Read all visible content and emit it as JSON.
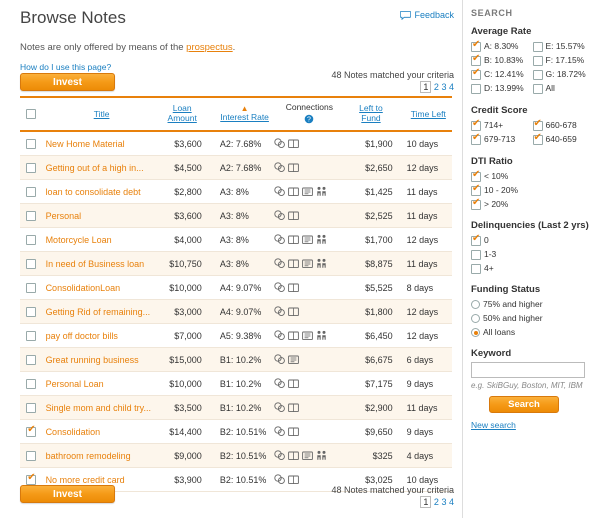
{
  "header": {
    "title": "Browse Notes",
    "feedback_label": "Feedback",
    "feedback_icon": "speech-bubble-icon"
  },
  "notice": {
    "text_before": "Notes are only offered by means of the ",
    "link": "prospectus",
    "text_after": "."
  },
  "howto_link": "How do I use this page?",
  "invest_button": "Invest",
  "results": {
    "matched_text": "48 Notes matched your criteria",
    "pages": [
      "1",
      "2",
      "3",
      "4"
    ],
    "current_page": "1"
  },
  "table": {
    "columns": {
      "select": "",
      "title": "Title",
      "loan_amount": "Loan Amount",
      "interest_rate": "Interest Rate",
      "connections": "Connections",
      "left_to_fund": "Left to Fund",
      "time_left": "Time Left"
    },
    "sorted_column": "interest_rate",
    "rows": [
      {
        "checked": false,
        "title": "New Home Material",
        "amount": "$3,600",
        "rate": "A2: 7.68%",
        "icons": [
          "group-icon",
          "book-icon"
        ],
        "fund": "$1,900",
        "time": "10 days"
      },
      {
        "checked": false,
        "title": "Getting out of a high in...",
        "amount": "$4,500",
        "rate": "A2: 7.68%",
        "icons": [
          "group-icon",
          "book-icon"
        ],
        "fund": "$2,650",
        "time": "12 days"
      },
      {
        "checked": false,
        "title": "loan to consolidate debt",
        "amount": "$2,800",
        "rate": "A3: 8%",
        "icons": [
          "group-icon",
          "book-icon",
          "book2-icon",
          "people-icon"
        ],
        "fund": "$1,425",
        "time": "11 days"
      },
      {
        "checked": false,
        "title": "Personal",
        "amount": "$3,600",
        "rate": "A3: 8%",
        "icons": [
          "group-icon",
          "book-icon"
        ],
        "fund": "$2,525",
        "time": "11 days"
      },
      {
        "checked": false,
        "title": "Motorcycle Loan",
        "amount": "$4,000",
        "rate": "A3: 8%",
        "icons": [
          "group-icon",
          "book-icon",
          "book2-icon",
          "people-icon"
        ],
        "fund": "$1,700",
        "time": "12 days"
      },
      {
        "checked": false,
        "title": "In need of Business loan",
        "amount": "$10,750",
        "rate": "A3: 8%",
        "icons": [
          "group-icon",
          "book-icon",
          "book2-icon",
          "people-icon"
        ],
        "fund": "$8,875",
        "time": "11 days"
      },
      {
        "checked": false,
        "title": "ConsolidationLoan",
        "amount": "$10,000",
        "rate": "A4: 9.07%",
        "icons": [
          "group-icon",
          "book-icon"
        ],
        "fund": "$5,525",
        "time": "8 days"
      },
      {
        "checked": false,
        "title": "Getting Rid of remaining...",
        "amount": "$3,000",
        "rate": "A4: 9.07%",
        "icons": [
          "group-icon",
          "book-icon"
        ],
        "fund": "$1,800",
        "time": "12 days"
      },
      {
        "checked": false,
        "title": "pay off doctor bills",
        "amount": "$7,000",
        "rate": "A5: 9.38%",
        "icons": [
          "group-icon",
          "book-icon",
          "book2-icon",
          "people-icon"
        ],
        "fund": "$6,450",
        "time": "12 days"
      },
      {
        "checked": false,
        "title": "Great running business",
        "amount": "$15,000",
        "rate": "B1: 10.2%",
        "icons": [
          "group-icon",
          "book2-icon"
        ],
        "fund": "$6,675",
        "time": "6 days"
      },
      {
        "checked": false,
        "title": "Personal Loan",
        "amount": "$10,000",
        "rate": "B1: 10.2%",
        "icons": [
          "group-icon",
          "book-icon"
        ],
        "fund": "$7,175",
        "time": "9 days"
      },
      {
        "checked": false,
        "title": "Single mom and child try...",
        "amount": "$3,500",
        "rate": "B1: 10.2%",
        "icons": [
          "group-icon",
          "book-icon"
        ],
        "fund": "$2,900",
        "time": "11 days"
      },
      {
        "checked": true,
        "title": "Consolidation",
        "amount": "$14,400",
        "rate": "B2: 10.51%",
        "icons": [
          "group-icon",
          "book-icon"
        ],
        "fund": "$9,650",
        "time": "9 days"
      },
      {
        "checked": false,
        "title": "bathroom remodeling",
        "amount": "$9,000",
        "rate": "B2: 10.51%",
        "icons": [
          "group-icon",
          "book-icon",
          "book2-icon",
          "people-icon"
        ],
        "fund": "$325",
        "time": "4 days"
      },
      {
        "checked": true,
        "title": "No more credit card",
        "amount": "$3,900",
        "rate": "B2: 10.51%",
        "icons": [
          "group-icon",
          "book-icon"
        ],
        "fund": "$3,025",
        "time": "10 days"
      }
    ]
  },
  "sidebar": {
    "search_header": "SEARCH",
    "average_rate": {
      "title": "Average Rate",
      "left": [
        {
          "label": "A: 8.30%",
          "checked": true
        },
        {
          "label": "B: 10.83%",
          "checked": true
        },
        {
          "label": "C: 12.41%",
          "checked": true
        },
        {
          "label": "D: 13.99%",
          "checked": false
        }
      ],
      "right": [
        {
          "label": "E: 15.57%",
          "checked": false
        },
        {
          "label": "F: 17.15%",
          "checked": false
        },
        {
          "label": "G: 18.72%",
          "checked": false
        },
        {
          "label": "All",
          "checked": false
        }
      ]
    },
    "credit_score": {
      "title": "Credit Score",
      "left": [
        {
          "label": "714+",
          "checked": true
        },
        {
          "label": "679-713",
          "checked": true
        }
      ],
      "right": [
        {
          "label": "660-678",
          "checked": true
        },
        {
          "label": "640-659",
          "checked": true
        }
      ]
    },
    "dti_ratio": {
      "title": "DTI Ratio",
      "options": [
        {
          "label": "< 10%",
          "checked": true
        },
        {
          "label": "10 - 20%",
          "checked": true
        },
        {
          "label": "> 20%",
          "checked": true
        }
      ]
    },
    "delinquencies": {
      "title": "Delinquencies (Last 2 yrs)",
      "options": [
        {
          "label": "0",
          "checked": true
        },
        {
          "label": "1-3",
          "checked": false
        },
        {
          "label": "4+",
          "checked": false
        }
      ]
    },
    "funding_status": {
      "title": "Funding Status",
      "options": [
        {
          "label": "75% and higher",
          "checked": false
        },
        {
          "label": "50% and higher",
          "checked": false
        },
        {
          "label": "All loans",
          "checked": true
        }
      ]
    },
    "keyword": {
      "title": "Keyword",
      "value": "",
      "placeholder": "",
      "hint": "e.g. SkiBGuy, Boston, MIT, IBM"
    },
    "search_button": "Search",
    "new_search_link": "New search"
  },
  "colors": {
    "accent_orange": "#e8810c",
    "link_blue": "#1a7fc1",
    "row_alt": "#fdf6ec"
  }
}
